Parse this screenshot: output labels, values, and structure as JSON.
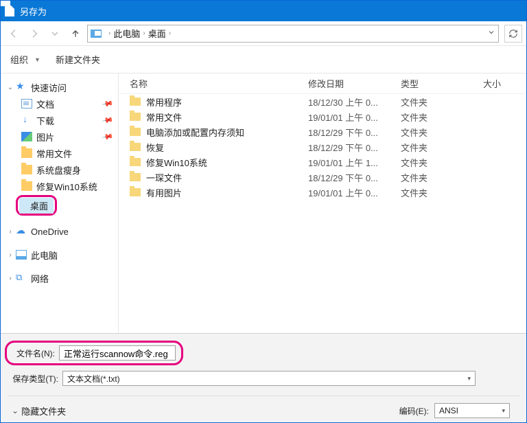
{
  "title": "另存为",
  "address": {
    "root": "此电脑",
    "folder": "桌面"
  },
  "toolbar": {
    "organize": "组织",
    "new_folder": "新建文件夹"
  },
  "tree": {
    "quick_access": "快速访问",
    "documents": "文档",
    "downloads": "下载",
    "pictures": "图片",
    "freq_files": "常用文件",
    "sys_slim": "系统盘瘦身",
    "fix_win10": "修复Win10系统",
    "desktop": "桌面",
    "onedrive": "OneDrive",
    "this_pc": "此电脑",
    "network": "网络"
  },
  "columns": {
    "name": "名称",
    "modified": "修改日期",
    "type": "类型",
    "size": "大小"
  },
  "rows": [
    {
      "name": "常用程序",
      "date": "18/12/30 上午 0...",
      "type": "文件夹"
    },
    {
      "name": "常用文件",
      "date": "19/01/01 上午 0...",
      "type": "文件夹"
    },
    {
      "name": "电脑添加或配置内存须知",
      "date": "18/12/29 下午 0...",
      "type": "文件夹"
    },
    {
      "name": "恢复",
      "date": "18/12/29 下午 0...",
      "type": "文件夹"
    },
    {
      "name": "修复Win10系统",
      "date": "19/01/01 上午 1...",
      "type": "文件夹"
    },
    {
      "name": "一琛文件",
      "date": "18/12/29 下午 0...",
      "type": "文件夹"
    },
    {
      "name": "有用图片",
      "date": "19/01/01 上午 0...",
      "type": "文件夹"
    }
  ],
  "filename_label": "文件名(N):",
  "filename_value": "正常运行scannow命令.reg",
  "filetype_label": "保存类型(T):",
  "filetype_value": "文本文档(*.txt)",
  "hide_folders": "隐藏文件夹",
  "encoding_label": "编码(E):",
  "encoding_value": "ANSI"
}
